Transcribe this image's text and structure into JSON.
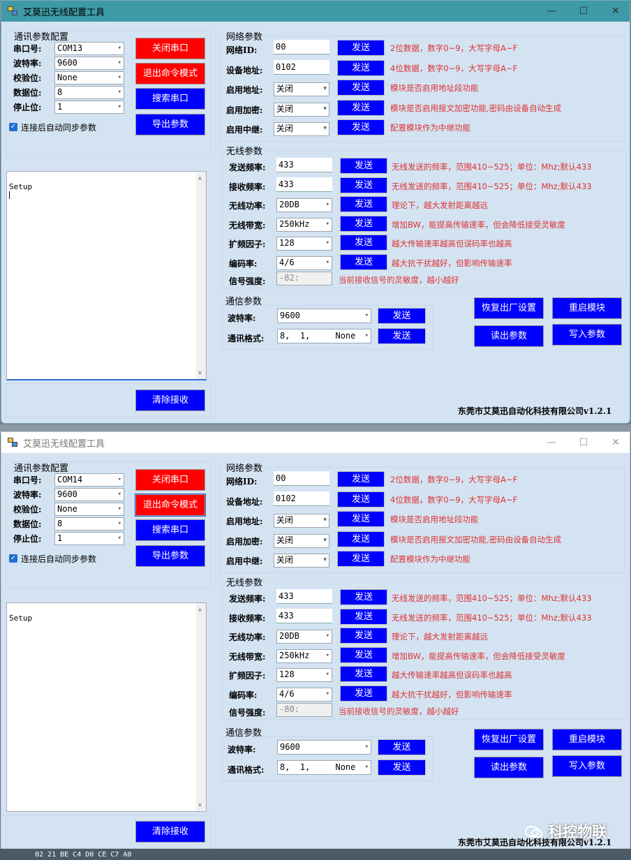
{
  "windows": [
    {
      "title": "艾莫迅无线配置工具",
      "comm_group": {
        "title": "通讯参数配置",
        "fields": [
          {
            "label": "串口号:",
            "value": "COM13"
          },
          {
            "label": "波特率:",
            "value": "9600"
          },
          {
            "label": "校验位:",
            "value": "None"
          },
          {
            "label": "数据位:",
            "value": "8"
          },
          {
            "label": "停止位:",
            "value": "1"
          }
        ],
        "buttons": [
          "关闭串口",
          "退出命令模式",
          "搜索串口",
          "导出参数"
        ],
        "auto_sync_label": "连接后自动同步参数",
        "auto_sync_checked": true
      },
      "receive_text": "Setup",
      "clear_button": "清除接收",
      "network_group": {
        "title": "网络参数",
        "rows": [
          {
            "label": "网络ID:",
            "value": "00",
            "type": "text",
            "hint": "2位数据，数字0~9，大写字母A~F"
          },
          {
            "label": "设备地址:",
            "value": "0102",
            "type": "text",
            "hint": "4位数据，数字0~9，大写字母A~F"
          },
          {
            "label": "启用地址:",
            "value": "关闭",
            "type": "combo",
            "hint": "模块是否启用地址段功能"
          },
          {
            "label": "启用加密:",
            "value": "关闭",
            "type": "combo",
            "hint": "模块是否启用报文加密功能,密码由设备自动生成"
          },
          {
            "label": "启用中继:",
            "value": "关闭",
            "type": "combo",
            "hint": "配置模块作为中继功能"
          }
        ]
      },
      "wireless_group": {
        "title": "无线参数",
        "rows": [
          {
            "label": "发送频率:",
            "value": "433",
            "type": "text",
            "hint": "无线发送的频率，范围410~525；单位：Mhz;默认433"
          },
          {
            "label": "接收频率:",
            "value": "433",
            "type": "text",
            "hint": "无线发送的频率，范围410~525；单位：Mhz;默认433"
          },
          {
            "label": "无线功率:",
            "value": "20DB",
            "type": "combo",
            "hint": "理论下，越大发射距离越远"
          },
          {
            "label": "无线带宽:",
            "value": "250kHz",
            "type": "combo",
            "hint": "增加BW，能提高传输速率，但会降低接受灵敏度"
          },
          {
            "label": "扩频因子:",
            "value": "128",
            "type": "combo",
            "hint": "越大传输速率越高但误码率也越高"
          },
          {
            "label": "编码率:",
            "value": "4/6",
            "type": "combo",
            "hint": "越大抗干扰越好，但影响传输速率"
          }
        ],
        "signal_label": "信号强度:",
        "signal_value": "-82:",
        "signal_hint": "当前接收信号的灵敏度，越小越好"
      },
      "comm_params_group": {
        "title": "通信参数",
        "rows": [
          {
            "label": "波特率:",
            "value": "9600"
          },
          {
            "label": "通讯格式:",
            "value": "8,  1,     None"
          }
        ]
      },
      "send_label": "发送",
      "action_buttons": [
        "恢复出厂设置",
        "重启模块",
        "读出参数",
        "写入参数"
      ],
      "footer": "东莞市艾莫迅自动化科技有限公司v1.2.1"
    },
    {
      "title": "艾莫迅无线配置工具",
      "comm_group": {
        "title": "通讯参数配置",
        "fields": [
          {
            "label": "串口号:",
            "value": "COM14"
          },
          {
            "label": "波特率:",
            "value": "9600"
          },
          {
            "label": "校验位:",
            "value": "None"
          },
          {
            "label": "数据位:",
            "value": "8"
          },
          {
            "label": "停止位:",
            "value": "1"
          }
        ],
        "buttons": [
          "关闭串口",
          "退出命令模式",
          "搜索串口",
          "导出参数"
        ],
        "auto_sync_label": "连接后自动同步参数",
        "auto_sync_checked": true
      },
      "receive_text": "Setup",
      "clear_button": "清除接收",
      "network_group": {
        "title": "网络参数",
        "rows": [
          {
            "label": "网络ID:",
            "value": "00",
            "type": "text",
            "hint": "2位数据，数字0~9，大写字母A~F"
          },
          {
            "label": "设备地址:",
            "value": "0102",
            "type": "text",
            "hint": "4位数据，数字0~9，大写字母A~F"
          },
          {
            "label": "启用地址:",
            "value": "关闭",
            "type": "combo",
            "hint": "模块是否启用地址段功能"
          },
          {
            "label": "启用加密:",
            "value": "关闭",
            "type": "combo",
            "hint": "模块是否启用报文加密功能,密码由设备自动生成"
          },
          {
            "label": "启用中继:",
            "value": "关闭",
            "type": "combo",
            "hint": "配置模块作为中继功能"
          }
        ]
      },
      "wireless_group": {
        "title": "无线参数",
        "rows": [
          {
            "label": "发送频率:",
            "value": "433",
            "type": "text",
            "hint": "无线发送的频率，范围410~525；单位：Mhz;默认433"
          },
          {
            "label": "接收频率:",
            "value": "433",
            "type": "text",
            "hint": "无线发送的频率，范围410~525；单位：Mhz;默认433"
          },
          {
            "label": "无线功率:",
            "value": "20DB",
            "type": "combo",
            "hint": "理论下，越大发射距离越远"
          },
          {
            "label": "无线带宽:",
            "value": "250kHz",
            "type": "combo",
            "hint": "增加BW，能提高传输速率，但会降低接受灵敏度"
          },
          {
            "label": "扩频因子:",
            "value": "128",
            "type": "combo",
            "hint": "越大传输速率越高但误码率也越高"
          },
          {
            "label": "编码率:",
            "value": "4/6",
            "type": "combo",
            "hint": "越大抗干扰越好，但影响传输速率"
          }
        ],
        "signal_label": "信号强度:",
        "signal_value": "-80:",
        "signal_hint": "当前接收信号的灵敏度，越小越好"
      },
      "comm_params_group": {
        "title": "通信参数",
        "rows": [
          {
            "label": "波特率:",
            "value": "9600"
          },
          {
            "label": "通讯格式:",
            "value": "8,  1,     None"
          }
        ]
      },
      "send_label": "发送",
      "action_buttons": [
        "恢复出厂设置",
        "重启模块",
        "读出参数",
        "写入参数"
      ],
      "footer": "东莞市艾莫迅自动化科技有限公司v1.2.1"
    }
  ],
  "window_controls": {
    "minimize": "—",
    "maximize": "☐",
    "close": "✕"
  },
  "watermark": "科控物联",
  "background_strip_text": "02 21 BE C4 D0 CE C7 A0",
  "colors": {
    "window_bg": "#d4e3f2",
    "title1_bg": "#3d9aa6",
    "title2_bg": "#ffffff",
    "red_button": "#ff0000",
    "blue_button": "#0000ff",
    "hint_red": "#d33333"
  }
}
